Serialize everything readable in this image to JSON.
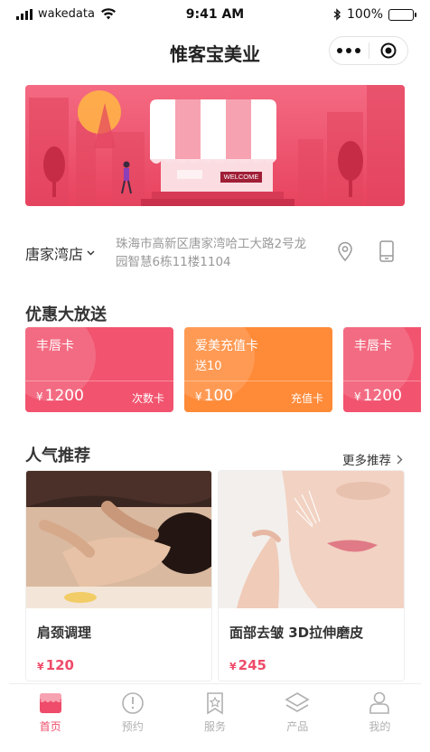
{
  "status_bar": {
    "carrier": "wakedata",
    "time": "9:41 AM",
    "battery": "100%",
    "battery_level": 1.0
  },
  "nav": {
    "title": "惟客宝美业"
  },
  "banner": {
    "sign_text": "WELCOME",
    "colors": {
      "bg_top": "#f05a75",
      "bg_bottom": "#e23d5a",
      "sun": "#ffb347"
    }
  },
  "store": {
    "name": "唐家湾店",
    "address": "珠海市高新区唐家湾哈工大路2号龙园智慧6栋11楼1104",
    "address_line1": "珠海市高新区唐家湾哈工大路2号龙",
    "address_line2": "园智慧6栋11楼1104"
  },
  "promo": {
    "title": "优惠大放送",
    "coupons": [
      {
        "name": "丰唇卡",
        "sub": "",
        "currency": "¥",
        "price": "1200",
        "type": "次数卡",
        "color": "#f2536e"
      },
      {
        "name": "爱美充值卡",
        "sub": "送10",
        "currency": "¥",
        "price": "100",
        "type": "充值卡",
        "color": "#ff8a38"
      },
      {
        "name": "丰唇卡",
        "sub": "",
        "currency": "¥",
        "price": "1200",
        "type": "",
        "color": "#f2536e"
      }
    ]
  },
  "recommend": {
    "title": "人气推荐",
    "more": "更多推荐",
    "products": [
      {
        "name": "肩颈调理",
        "currency": "¥",
        "price": "120"
      },
      {
        "name": "面部去皱 3D拉伸磨皮",
        "currency": "¥",
        "price": "245"
      }
    ]
  },
  "tabbar": {
    "active_color": "#ee4c6a",
    "items": [
      {
        "label": "首页",
        "icon": "shop-icon",
        "active": true
      },
      {
        "label": "预约",
        "icon": "alert-circle-icon",
        "active": false
      },
      {
        "label": "服务",
        "icon": "bookmark-star-icon",
        "active": false
      },
      {
        "label": "产品",
        "icon": "layers-icon",
        "active": false
      },
      {
        "label": "我的",
        "icon": "user-icon",
        "active": false
      }
    ]
  }
}
